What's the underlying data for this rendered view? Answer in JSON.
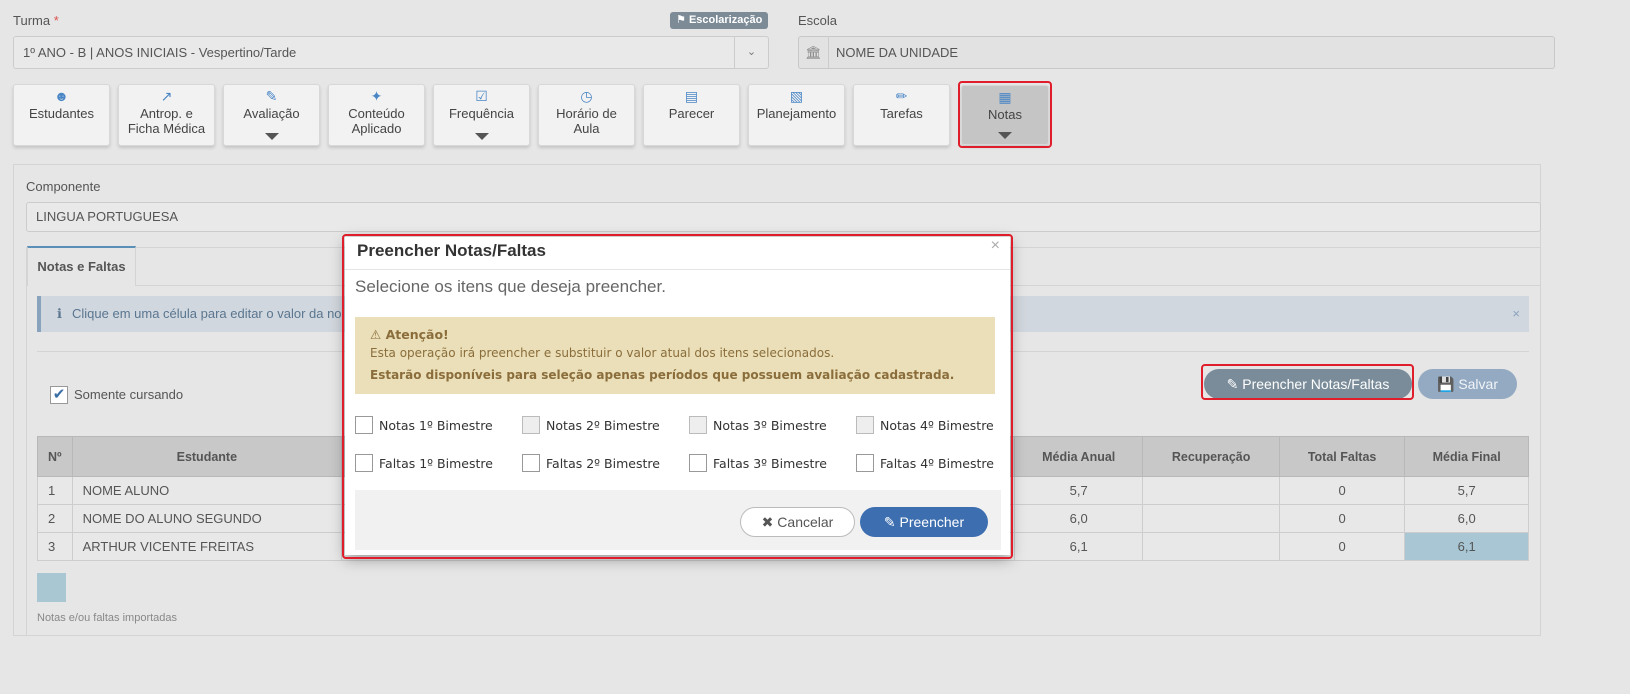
{
  "header": {
    "turma_label": "Turma",
    "required_mark": "*",
    "turma_value": "1º ANO - B | ANOS INICIAIS - Vespertino/Tarde",
    "escolarizacao_badge": "Escolarização",
    "escola_label": "Escola",
    "escola_value": "NOME DA UNIDADE"
  },
  "toolbar": {
    "estudantes": "Estudantes",
    "antrop_line1": "Antrop. e",
    "antrop_line2": "Ficha Médica",
    "avaliacao": "Avaliação",
    "conteudo_line1": "Conteúdo",
    "conteudo_line2": "Aplicado",
    "frequencia": "Frequência",
    "horario_line1": "Horário de",
    "horario_line2": "Aula",
    "parecer": "Parecer",
    "planejamento": "Planejamento",
    "tarefas": "Tarefas",
    "notas": "Notas"
  },
  "main": {
    "componente_label": "Componente",
    "componente_value": "LINGUA PORTUGUESA",
    "tab_label": "Notas e Faltas",
    "info_text": "Clique em uma célula para editar o valor da no",
    "somente_cursando": "Somente cursando",
    "fill_button": "Preencher Notas/Faltas",
    "save_button": "Salvar",
    "legend_text": "Notas e/ou faltas importadas"
  },
  "table": {
    "headers": {
      "num": "Nº",
      "estudante": "Estudante",
      "media_anual": "Média Anual",
      "recuperacao": "Recuperação",
      "total_faltas": "Total Faltas",
      "media_final": "Média Final"
    },
    "rows": [
      {
        "num": "1",
        "name": "NOME ALUNO",
        "media_anual": "5,7",
        "recuperacao": "",
        "total_faltas": "0",
        "media_final": "5,7"
      },
      {
        "num": "2",
        "name": "NOME DO ALUNO SEGUNDO",
        "media_anual": "6,0",
        "recuperacao": "",
        "total_faltas": "0",
        "media_final": "6,0"
      },
      {
        "num": "3",
        "name": "ARTHUR VICENTE FREITAS",
        "media_anual": "6,1",
        "recuperacao": "",
        "total_faltas": "0",
        "media_final": "6,1"
      }
    ]
  },
  "modal": {
    "title": "Preencher Notas/Faltas",
    "close": "×",
    "subtitle": "Selecione os itens que deseja preencher.",
    "warning_title": "Atenção!",
    "warning_line1": "Esta operação irá preencher e substituir o valor atual dos itens selecionados.",
    "warning_line2": "Estarão disponíveis para seleção apenas períodos que possuem avaliação cadastrada.",
    "checks": {
      "n1": "Notas 1º Bimestre",
      "n2": "Notas 2º Bimestre",
      "n3": "Notas 3º Bimestre",
      "n4": "Notas 4º Bimestre",
      "f1": "Faltas 1º Bimestre",
      "f2": "Faltas 2º Bimestre",
      "f3": "Faltas 3º Bimestre",
      "f4": "Faltas 4º Bimestre"
    },
    "cancel": "Cancelar",
    "submit": "Preencher"
  },
  "colors": {
    "accent": "#3d6fb0",
    "highlight_outline": "#e01e2b",
    "warning_bg": "#eadfb8",
    "low_grade": "#a2313c",
    "ok_grade": "#4a79a8"
  }
}
